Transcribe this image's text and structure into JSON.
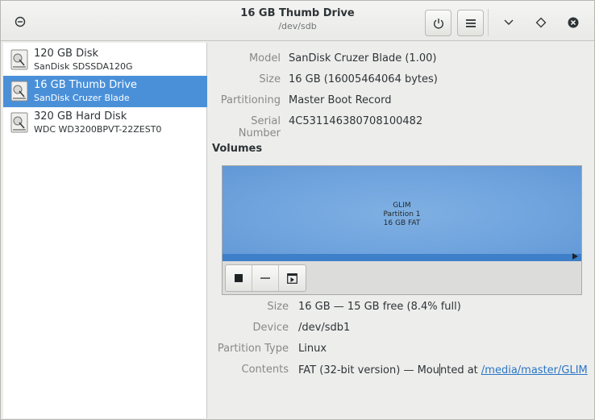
{
  "header": {
    "title": "16 GB Thumb Drive",
    "subtitle": "/dev/sdb"
  },
  "icons": {
    "left": "power-icon",
    "power": "power-icon",
    "menu": "hamburger-menu-icon",
    "minimize": "chevron-down-icon",
    "maximize": "diamond-icon",
    "close": "close-icon"
  },
  "sidebar": {
    "drives": [
      {
        "name": "120 GB Disk",
        "model": "SanDisk SDSSDA120G",
        "selected": false
      },
      {
        "name": "16 GB Thumb Drive",
        "model": "SanDisk Cruzer Blade",
        "selected": true
      },
      {
        "name": "320 GB Hard Disk",
        "model": "WDC WD3200BPVT-22ZEST0",
        "selected": false
      }
    ]
  },
  "drive_info": {
    "model_label": "Model",
    "model": "SanDisk Cruzer Blade (1.00)",
    "size_label": "Size",
    "size": "16 GB (16005464064 bytes)",
    "partitioning_label": "Partitioning",
    "partitioning": "Master Boot Record",
    "serial_label": "Serial Number",
    "serial": "4C531146380708100482"
  },
  "volumes": {
    "title": "Volumes",
    "partition": {
      "name": "GLIM",
      "line2": "Partition 1",
      "line3": "16 GB FAT"
    }
  },
  "partition_info": {
    "size_label": "Size",
    "size": "16 GB — 15 GB free (8.4% full)",
    "device_label": "Device",
    "device": "/dev/sdb1",
    "type_label": "Partition Type",
    "type": "Linux",
    "contents_label": "Contents",
    "contents_pre": "FAT (32-bit version) — Mou",
    "contents_mid": "nted at ",
    "contents_link": "/media/master/GLIM"
  },
  "colors": {
    "selection": "#4a90d9",
    "volume_fill": "#6fa3dd",
    "link": "#2a76c6"
  }
}
